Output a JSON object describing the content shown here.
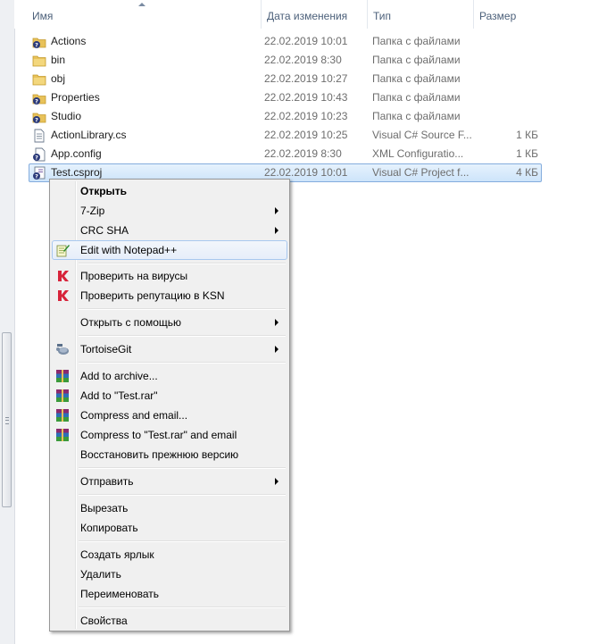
{
  "columns": {
    "name": "Имя",
    "date": "Дата изменения",
    "type": "Тип",
    "size": "Размер"
  },
  "files": [
    {
      "name": "Actions",
      "date": "22.02.2019 10:01",
      "type": "Папка с файлами",
      "size": "",
      "icon": "folder-badge-icon"
    },
    {
      "name": "bin",
      "date": "22.02.2019 8:30",
      "type": "Папка с файлами",
      "size": "",
      "icon": "folder-icon"
    },
    {
      "name": "obj",
      "date": "22.02.2019 10:27",
      "type": "Папка с файлами",
      "size": "",
      "icon": "folder-icon"
    },
    {
      "name": "Properties",
      "date": "22.02.2019 10:43",
      "type": "Папка с файлами",
      "size": "",
      "icon": "folder-badge-icon"
    },
    {
      "name": "Studio",
      "date": "22.02.2019 10:23",
      "type": "Папка с файлами",
      "size": "",
      "icon": "folder-badge-icon"
    },
    {
      "name": "ActionLibrary.cs",
      "date": "22.02.2019 10:25",
      "type": "Visual C# Source F...",
      "size": "1 КБ",
      "icon": "cs-file-icon"
    },
    {
      "name": "App.config",
      "date": "22.02.2019 8:30",
      "type": "XML Configuratio...",
      "size": "1 КБ",
      "icon": "config-file-icon"
    },
    {
      "name": "Test.csproj",
      "date": "22.02.2019 10:01",
      "type": "Visual C# Project f...",
      "size": "4 КБ",
      "icon": "csproj-file-icon"
    }
  ],
  "menu": {
    "open": "Открыть",
    "zip7": "7-Zip",
    "crcsha": "CRC SHA",
    "notepad": "Edit with Notepad++",
    "scan": "Проверить на вирусы",
    "ksn": "Проверить репутацию в KSN",
    "open_with": "Открыть с помощью",
    "tortoise": "TortoiseGit",
    "add_archive": "Add to archive...",
    "add_rar": "Add to \"Test.rar\"",
    "compress_email": "Compress and email...",
    "compress_rar_email": "Compress to \"Test.rar\" and email",
    "restore": "Восстановить прежнюю версию",
    "send_to": "Отправить",
    "cut": "Вырезать",
    "copy": "Копировать",
    "shortcut": "Создать ярлык",
    "delete": "Удалить",
    "rename": "Переименовать",
    "properties": "Свойства"
  },
  "colors": {
    "selection_border": "#84acdd",
    "header_text": "#4c607a",
    "folder": "#e8c25a",
    "kaspersky": "#d7233a",
    "winrar": "#8a2a6e"
  }
}
